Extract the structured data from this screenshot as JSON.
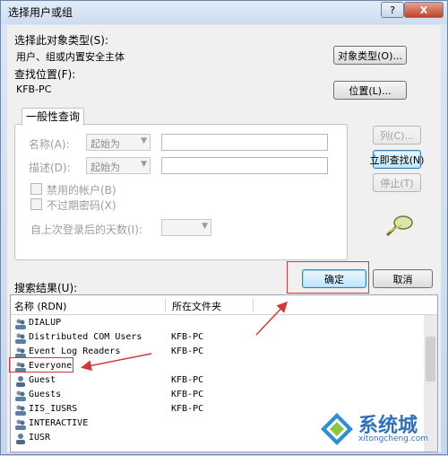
{
  "window": {
    "title": "选择用户或组",
    "help_glyph": "?",
    "close_glyph": "X"
  },
  "object_type": {
    "label": "选择此对象类型(S):",
    "value": "用户、组或内置安全主体",
    "button": "对象类型(O)..."
  },
  "location": {
    "label": "查找位置(F):",
    "value": "KFB-PC",
    "button": "位置(L)..."
  },
  "query": {
    "tab": "一般性查询",
    "name_label": "名称(A):",
    "name_mode": "起始为",
    "desc_label": "描述(D):",
    "desc_mode": "起始为",
    "disabled_accounts": "禁用的帐户(B)",
    "no_expire_pwd": "不过期密码(X)",
    "days_since_login": "自上次登录后的天数(I):"
  },
  "side_buttons": {
    "columns": "列(C)...",
    "find_now": "立即查找(N)",
    "stop": "停止(T)"
  },
  "actions": {
    "ok": "确定",
    "cancel": "取消"
  },
  "results": {
    "label": "搜索结果(U):",
    "columns": [
      "名称 (RDN)",
      "所在文件夹"
    ],
    "rows": [
      {
        "name": "DIALUP",
        "folder": ""
      },
      {
        "name": "Distributed COM Users",
        "folder": "KFB-PC"
      },
      {
        "name": "Event Log Readers",
        "folder": "KFB-PC"
      },
      {
        "name": "Everyone",
        "folder": ""
      },
      {
        "name": "Guest",
        "folder": "KFB-PC"
      },
      {
        "name": "Guests",
        "folder": "KFB-PC"
      },
      {
        "name": "IIS_IUSRS",
        "folder": "KFB-PC"
      },
      {
        "name": "INTERACTIVE",
        "folder": ""
      },
      {
        "name": "IUSR",
        "folder": ""
      }
    ]
  },
  "watermark": {
    "brand": "系统城",
    "url": "xitongcheng.com"
  },
  "colors": {
    "annotation": "#d03a3a",
    "accent": "#3c7fb1"
  }
}
